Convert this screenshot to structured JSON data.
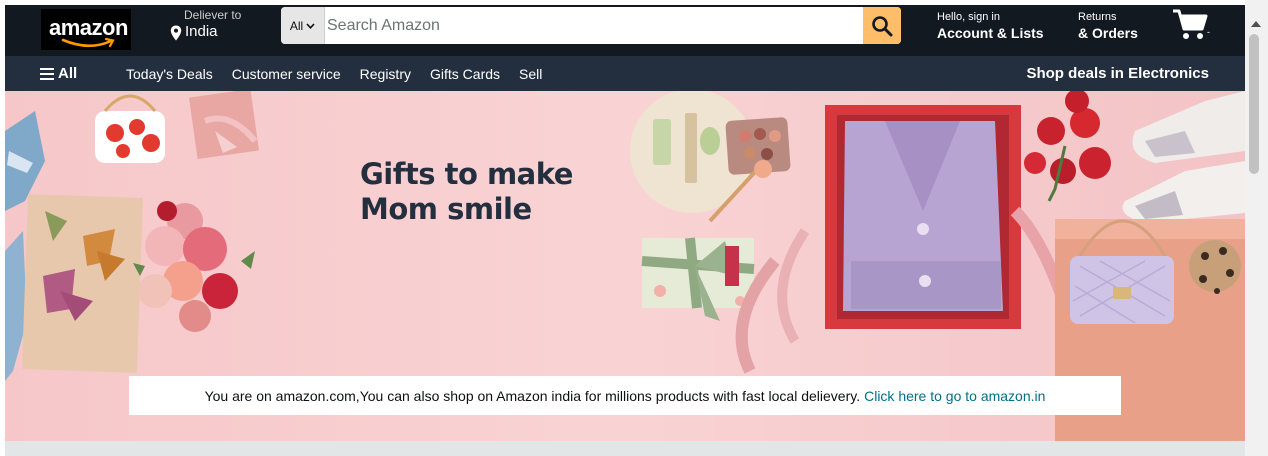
{
  "header": {
    "logo_text": "amazon",
    "deliver_to_label": "Deliever to",
    "deliver_to_location": "India",
    "search": {
      "category": "All",
      "placeholder": "Search Amazon",
      "value": ""
    },
    "account": {
      "greeting": "Hello, sign in",
      "label": "Account & Lists"
    },
    "returns": {
      "line1": "Returns",
      "line2": "& Orders"
    },
    "cart_count": "-"
  },
  "subnav": {
    "all_label": "All",
    "links": [
      "Today's Deals",
      "Customer service",
      "Registry",
      "Gifts Cards",
      "Sell"
    ],
    "promo": "Shop deals in Electronics"
  },
  "hero": {
    "title_line1": "Gifts to make",
    "title_line2": "Mom smile"
  },
  "notice": {
    "text": "You are on amazon.com,You can also shop on Amazon india for millions products with fast local delievery.",
    "link": "Click here to go to amazon.in"
  },
  "colors": {
    "nav_top": "#131921",
    "nav_bottom": "#232f3e",
    "search_button": "#febd69",
    "hero_background": "#f7c9cc",
    "link": "#007185"
  },
  "icons": [
    "location-pin-icon",
    "chevron-down-icon",
    "search-icon",
    "cart-icon",
    "hamburger-icon"
  ]
}
